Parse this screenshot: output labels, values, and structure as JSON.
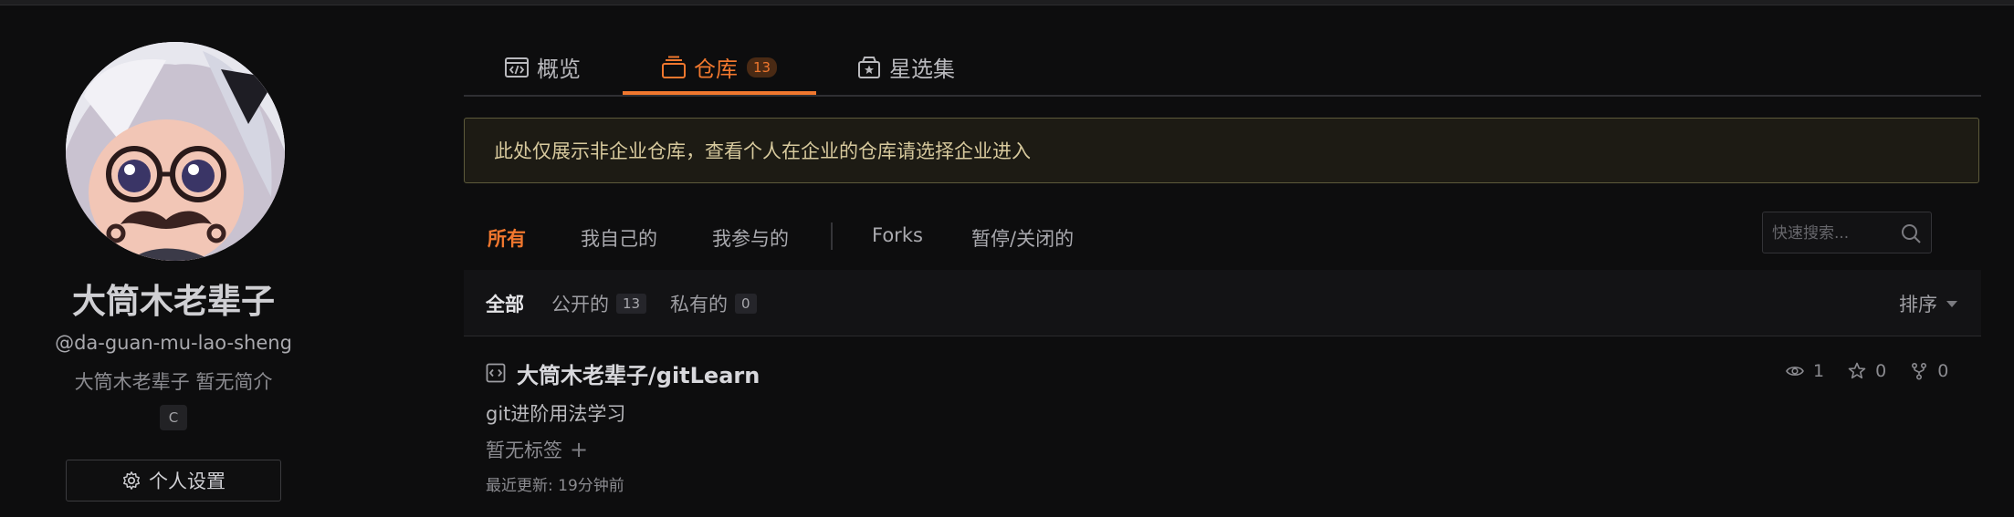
{
  "user": {
    "name": "大筒木老辈子",
    "handle": "@da-guan-mu-lao-sheng",
    "bio": "大筒木老辈子 暂无简介",
    "language_badge": "C",
    "settings_label": "个人设置"
  },
  "tabs": [
    {
      "label": "概览",
      "icon": "code-window-icon"
    },
    {
      "label": "仓库",
      "icon": "repo-stack-icon",
      "count": "13"
    },
    {
      "label": "星选集",
      "icon": "star-box-icon"
    }
  ],
  "notice": "此处仅展示非企业仓库，查看个人在企业的仓库请选择企业进入",
  "filters": {
    "items": [
      "所有",
      "我自己的",
      "我参与的",
      "Forks",
      "暂停/关闭的"
    ],
    "search_placeholder": "快速搜索..."
  },
  "subfilters": {
    "all": "全部",
    "public": "公开的",
    "public_count": "13",
    "private": "私有的",
    "private_count": "0",
    "sort": "排序"
  },
  "repo": {
    "title": "大筒木老辈子/gitLearn",
    "description": "git进阶用法学习",
    "tags": "暂无标签",
    "updated": "最近更新: 19分钟前",
    "watchers": "1",
    "stars": "0",
    "forks": "0"
  },
  "colors": {
    "accent": "#f0772e",
    "background": "#0d0d0e",
    "notice_border": "#5d5a3b"
  }
}
